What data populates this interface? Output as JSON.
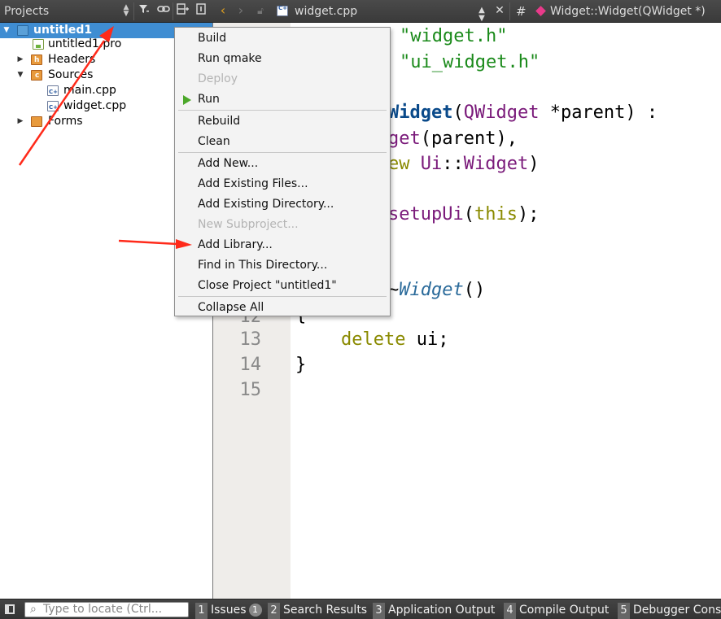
{
  "projects_panel": {
    "title": "Projects",
    "toolbar_icons": [
      "sort-arrows-icon",
      "filter-icon",
      "link-icon",
      "split-icon",
      "close-panel-icon"
    ],
    "tree": [
      {
        "label": "untitled1",
        "icon": "project-icon",
        "expanded": true,
        "selected": true
      },
      {
        "label": "untitled1.pro",
        "icon": "pro-file-icon"
      },
      {
        "label": "Headers",
        "icon": "headers-folder-icon",
        "expanded": false
      },
      {
        "label": "Sources",
        "icon": "sources-folder-icon",
        "expanded": true
      },
      {
        "label": "main.cpp",
        "icon": "cpp-file-icon"
      },
      {
        "label": "widget.cpp",
        "icon": "cpp-file-icon"
      },
      {
        "label": "Forms",
        "icon": "forms-folder-icon",
        "expanded": false
      }
    ]
  },
  "editor": {
    "file_name": "widget.cpp",
    "symbol": "Widget::Widget(QWidget *)",
    "hash": "#",
    "line_numbers": [
      "13",
      "14",
      "15"
    ],
    "code": {
      "l1_str": "\"widget.h\"",
      "l2_str": "\"ui_widget.h\"",
      "l3_fn": "Widget",
      "l3_open": "(",
      "l3_type": "QWidget",
      "l3_rest": " *parent) :",
      "l4_a": "get",
      "l4_b": "(parent),",
      "l5_a": "ew",
      "l5_b": " Ui",
      "l5_c": "::",
      "l5_d": "Widget",
      "l5_e": ")",
      "l6_a": "setupUi",
      "l6_b": "(",
      "l6_c": "this",
      "l6_d": ");",
      "l8_a": "~",
      "l8_b": "Widget",
      "l8_c": "()",
      "l9": "{",
      "l9_num": "12",
      "l10_kw": "delete",
      "l10_rest": " ui;",
      "l11": "}"
    }
  },
  "context_menu": {
    "items": [
      {
        "label": "Build",
        "enabled": true
      },
      {
        "label": "Run qmake",
        "enabled": true
      },
      {
        "label": "Deploy",
        "enabled": false
      },
      {
        "label": "Run",
        "enabled": true,
        "icon": "run-icon"
      },
      {
        "label": "Rebuild",
        "enabled": true
      },
      {
        "label": "Clean",
        "enabled": true
      },
      {
        "label": "Add New...",
        "enabled": true
      },
      {
        "label": "Add Existing Files...",
        "enabled": true
      },
      {
        "label": "Add Existing Directory...",
        "enabled": true
      },
      {
        "label": "New Subproject...",
        "enabled": false
      },
      {
        "label": "Add Library...",
        "enabled": true
      },
      {
        "label": "Find in This Directory...",
        "enabled": true
      },
      {
        "label": "Close Project \"untitled1\"",
        "enabled": true
      },
      {
        "label": "Collapse All",
        "enabled": true
      }
    ]
  },
  "status_bar": {
    "locator_placeholder": "Type to locate (Ctrl...",
    "tabs": [
      {
        "num": "1",
        "label": "Issues",
        "badge": "1"
      },
      {
        "num": "2",
        "label": "Search Results"
      },
      {
        "num": "3",
        "label": "Application Output"
      },
      {
        "num": "4",
        "label": "Compile Output"
      },
      {
        "num": "5",
        "label": "Debugger Cons"
      }
    ]
  },
  "colors": {
    "selection": "#3f8dd2",
    "toolbar_bg": "#404040",
    "annotation_arrow": "#ff2a1a",
    "run_icon": "#4ca82a"
  }
}
